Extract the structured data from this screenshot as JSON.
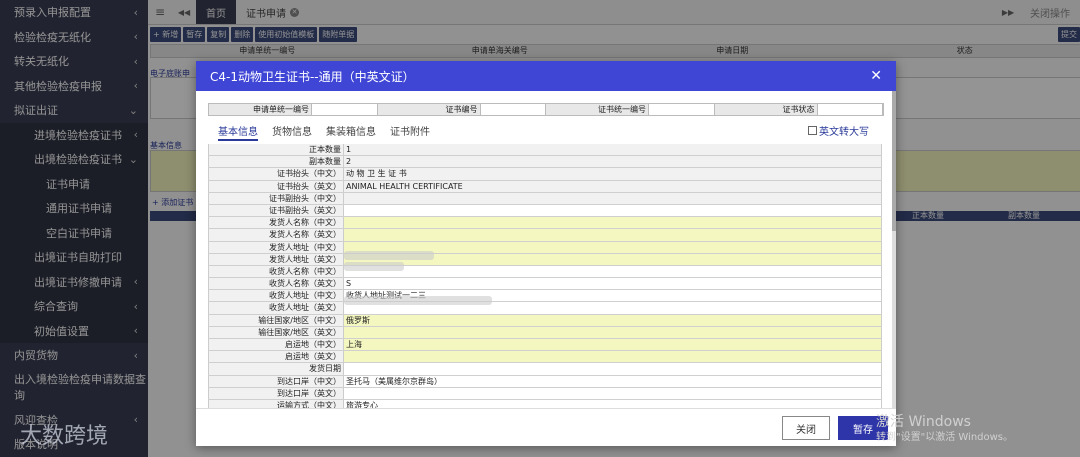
{
  "sidebar": {
    "items": [
      {
        "label": "预录入申报配置",
        "chev": "‹",
        "cls": ""
      },
      {
        "label": "检验检疫无纸化",
        "chev": "‹",
        "cls": ""
      },
      {
        "label": "转关无纸化",
        "chev": "‹",
        "cls": ""
      },
      {
        "label": "其他检验检疫申报",
        "chev": "‹",
        "cls": ""
      },
      {
        "label": "拟证出证",
        "chev": "⌄",
        "cls": ""
      },
      {
        "label": "进境检验检疫证书",
        "chev": "‹",
        "cls": "lvl2 active-parent"
      },
      {
        "label": "出境检验检疫证书",
        "chev": "⌄",
        "cls": "lvl2 active-parent"
      },
      {
        "label": "证书申请",
        "chev": "",
        "cls": "lvl3"
      },
      {
        "label": "通用证书申请",
        "chev": "",
        "cls": "lvl3"
      },
      {
        "label": "空白证书申请",
        "chev": "",
        "cls": "lvl3"
      },
      {
        "label": "出境证书自助打印",
        "chev": "",
        "cls": "lvl2 active-parent"
      },
      {
        "label": "出境证书修撤申请",
        "chev": "‹",
        "cls": "lvl2 active-parent"
      },
      {
        "label": "综合查询",
        "chev": "‹",
        "cls": "lvl2 active-parent"
      },
      {
        "label": "初始值设置",
        "chev": "‹",
        "cls": "lvl2 active-parent"
      },
      {
        "label": "内贸货物",
        "chev": "‹",
        "cls": ""
      },
      {
        "label": "出入境检验检疫申请数据查询",
        "chev": "",
        "cls": "multi"
      },
      {
        "label": "风迎查检",
        "chev": "‹",
        "cls": ""
      },
      {
        "label": "版本说明",
        "chev": "",
        "cls": ""
      }
    ]
  },
  "topbar": {
    "menu_icon": "≡",
    "back_icon": "◀◀",
    "home_tab": "首页",
    "cert_tab": "证书申请",
    "cert_tab_close": "✕",
    "forward_icon": "▶▶",
    "close_ops": "关闭操作"
  },
  "toolbar": {
    "buttons": [
      "+ 新增",
      "暂存",
      "复制",
      "删除",
      "使用初始值模板",
      "随附单据"
    ],
    "submit": "提交"
  },
  "bg_table": {
    "headers": [
      "申请单统一编号",
      "申请单海关编号",
      "申请日期",
      "状态"
    ],
    "left_labels": [
      "电子底账申",
      "基本信息",
      "+ 添加证书"
    ],
    "right_headers": [
      "正本数量",
      "副本数量"
    ]
  },
  "modal": {
    "title": "C4-1动物卫生证书--通用（中英文证）",
    "close_icon": "✕",
    "info_labels": [
      "申请单统一编号",
      "证书编号",
      "证书统一编号",
      "证书状态"
    ],
    "tabs": [
      "基本信息",
      "货物信息",
      "集装箱信息",
      "证书附件"
    ],
    "uppercase_label": "英文转大写",
    "rows": [
      {
        "label": "正本数量",
        "value": "1",
        "style": ""
      },
      {
        "label": "副本数量",
        "value": "2",
        "style": ""
      },
      {
        "label": "证书抬头（中文）",
        "value": "动 物 卫 生 证 书",
        "style": ""
      },
      {
        "label": "证书抬头（英文）",
        "value": "ANIMAL HEALTH CERTIFICATE",
        "style": ""
      },
      {
        "label": "证书副抬头（中文）",
        "value": "",
        "style": ""
      },
      {
        "label": "证书副抬头（英文）",
        "value": "",
        "style": "white"
      },
      {
        "label": "发货人名称（中文）",
        "value": "",
        "style": "yellow"
      },
      {
        "label": "发货人名称（英文）",
        "value": "",
        "style": "yellow"
      },
      {
        "label": "发货人地址（中文）",
        "value": "",
        "style": "yellow"
      },
      {
        "label": "发货人地址（英文）",
        "value": "",
        "style": "yellow"
      },
      {
        "label": "收货人名称（中文）",
        "value": "",
        "style": "white"
      },
      {
        "label": "收货人名称（英文）",
        "value": "S",
        "style": "white"
      },
      {
        "label": "收货人地址（中文）",
        "value": "收货人地址测试一二三",
        "style": "white"
      },
      {
        "label": "收货人地址（英文）",
        "value": "",
        "style": "white"
      },
      {
        "label": "输往国家/地区（中文）",
        "value": "俄罗斯",
        "style": "yellow"
      },
      {
        "label": "输往国家/地区（英文）",
        "value": "",
        "style": "yellow"
      },
      {
        "label": "启运地（中文）",
        "value": "上海",
        "style": "yellow"
      },
      {
        "label": "启运地（英文）",
        "value": "",
        "style": "yellow"
      },
      {
        "label": "发货日期",
        "value": "",
        "style": "white"
      },
      {
        "label": "到达口岸（中文）",
        "value": "圣托马（美属维尔京群岛）",
        "style": "white"
      },
      {
        "label": "到达口岸（英文）",
        "value": "",
        "style": "white"
      },
      {
        "label": "运输方式（中文）",
        "value": "旅游专心",
        "style": "white"
      }
    ],
    "close_button": "关闭",
    "save_button": "暂存"
  },
  "watermark": "大数跨境",
  "activate": {
    "title": "激活 Windows",
    "sub": "转到\"设置\"以激活 Windows。"
  }
}
